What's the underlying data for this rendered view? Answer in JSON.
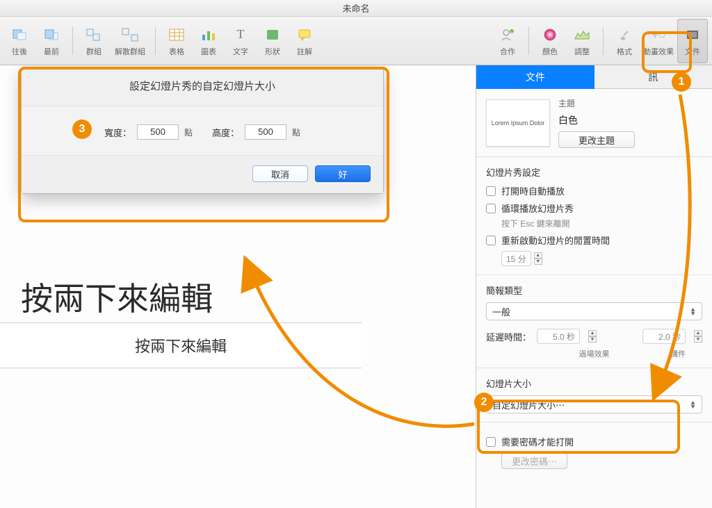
{
  "window_title": "未命名",
  "toolbar": {
    "back": "往後",
    "front": "最前",
    "group": "群組",
    "ungroup": "解散群組",
    "table": "表格",
    "chart": "圖表",
    "text": "文字",
    "shape": "形狀",
    "comment": "註解",
    "collab": "合作",
    "color": "顏色",
    "adjust": "調整",
    "format": "格式",
    "animate": "動畫效果",
    "document": "文件"
  },
  "dialog": {
    "title": "設定幻燈片秀的自定幻燈片大小",
    "width_label": "寬度：",
    "height_label": "高度：",
    "width_value": "500",
    "height_value": "500",
    "unit": "點",
    "cancel": "取消",
    "ok": "好"
  },
  "slide": {
    "title_placeholder": "按兩下來編輯",
    "body_placeholder": "按兩下來編輯"
  },
  "inspector": {
    "tabs": {
      "document": "文件",
      "info": "訊"
    },
    "theme": {
      "label": "主題",
      "name": "白色",
      "thumb_text": "Lorem Ipsum Dolor",
      "change": "更改主題"
    },
    "slideshow": {
      "title": "幻燈片秀設定",
      "autoplay": "打開時自動播放",
      "loop": "循環播放幻燈片秀",
      "loop_hint": "按下 Esc 鍵來離開",
      "restart": "重新啟動幻燈片的閒置時間",
      "idle_value": "15 分"
    },
    "presentation": {
      "title": "簡報類型",
      "type": "一般",
      "delay_label": "延遲時間：",
      "delay_value": "5.0 秒",
      "trans_value": "2.0 秒",
      "trans_label": "過場效果",
      "build_label": "構件"
    },
    "slidesize": {
      "title": "幻燈片大小",
      "value": "自定幻燈片大小⋯"
    },
    "password": {
      "label": "需要密碼才能打開",
      "change": "更改密碼⋯"
    }
  },
  "badges": {
    "one": "1",
    "two": "2",
    "three": "3"
  }
}
